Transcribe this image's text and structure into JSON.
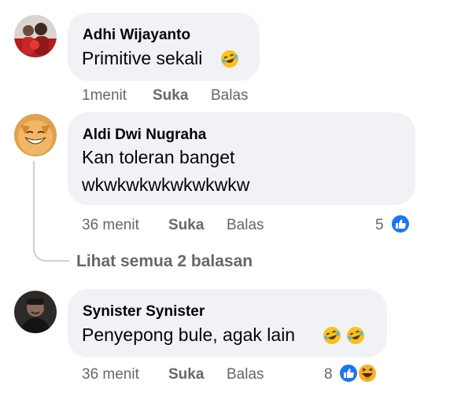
{
  "comments": [
    {
      "author": "Adhi Wijayanto",
      "text": "Primitive sekali",
      "emoji": [
        "laughing-face"
      ],
      "time": "1menit",
      "like_label": "Suka",
      "reply_label": "Balas"
    },
    {
      "author": "Aldi Dwi Nugraha",
      "text_line1": "Kan toleran banget",
      "text_line2": "wkwkwkwkwkwkwkw",
      "time": "36 menit",
      "like_label": "Suka",
      "reply_label": "Balas",
      "reaction_count": "5",
      "reactions": [
        "like"
      ]
    },
    {
      "author": "Synister Synister",
      "text": "Penyepong bule, agak lain",
      "emoji": [
        "laughing-face",
        "laughing-face"
      ],
      "time": "36 menit",
      "like_label": "Suka",
      "reply_label": "Balas",
      "reaction_count": "8",
      "reactions": [
        "like",
        "haha"
      ]
    }
  ],
  "view_replies_label": "Lihat semua 2 balasan",
  "colors": {
    "bubble": "#f0f2f5",
    "meta_text": "#65676b",
    "like_blue": "#1877f2",
    "haha_yellow": "#f7b125"
  }
}
